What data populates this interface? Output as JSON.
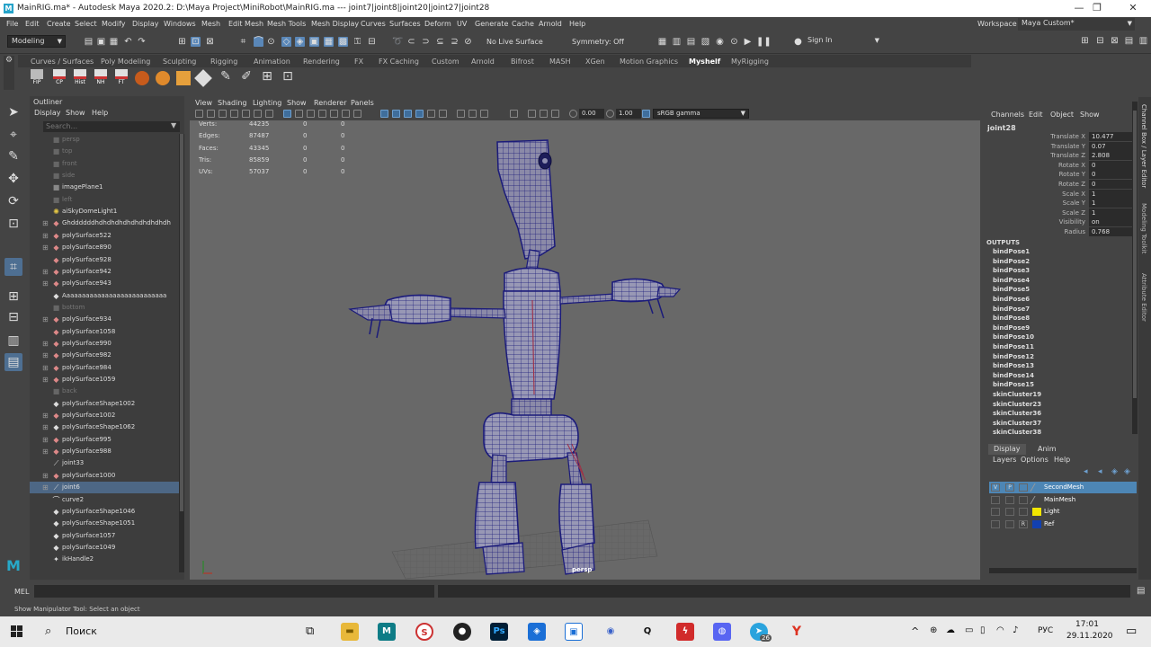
{
  "window": {
    "title": "MainRIG.ma* - Autodesk Maya 2020.2: D:\\Maya Project\\MiniRobot\\MainRIG.ma   ---   joint7|joint8|joint20|joint27|joint28",
    "logo": "M",
    "controls": [
      "—",
      "❐",
      "✕"
    ]
  },
  "menubar": {
    "items": [
      "File",
      "Edit",
      "Create",
      "Select",
      "Modify",
      "Display",
      "Windows",
      "Mesh",
      "Edit Mesh",
      "Mesh Tools",
      "Mesh Display",
      "Curves",
      "Surfaces",
      "Deform",
      "UV",
      "Generate",
      "Cache",
      "Arnold",
      "Help"
    ],
    "workspace_label": "Workspace :",
    "workspace_value": "Maya Custom*"
  },
  "statusline": {
    "mode": "Modeling",
    "live_surface": "No Live Surface",
    "symmetry": "Symmetry: Off",
    "sign_in": "Sign In"
  },
  "shelf": {
    "tabs": [
      "Curves / Surfaces",
      "Poly Modeling",
      "Sculpting",
      "Rigging",
      "Animation",
      "Rendering",
      "FX",
      "FX Caching",
      "Custom",
      "Arnold",
      "Bifrost",
      "MASH",
      "XGen",
      "Motion Graphics",
      "Myshelf",
      "MyRigging"
    ],
    "active": "Myshelf",
    "buttons": [
      "FIP",
      "CP",
      "Hist",
      "NH",
      "FT"
    ]
  },
  "outliner": {
    "title": "Outliner",
    "menu": [
      "Display",
      "Show",
      "Help"
    ],
    "search_placeholder": "Search...",
    "items": [
      {
        "label": "persp",
        "icon": "camera-icon",
        "dim": true,
        "expand": false
      },
      {
        "label": "top",
        "icon": "camera-icon",
        "dim": true,
        "expand": false
      },
      {
        "label": "front",
        "icon": "camera-icon",
        "dim": true,
        "expand": false
      },
      {
        "label": "side",
        "icon": "camera-icon",
        "dim": true,
        "expand": false
      },
      {
        "label": "imagePlane1",
        "icon": "camera-icon",
        "dim": false,
        "expand": false
      },
      {
        "label": "left",
        "icon": "camera-icon",
        "dim": true,
        "expand": false
      },
      {
        "label": "aiSkyDomeLight1",
        "icon": "light-icon",
        "dim": false,
        "expand": false
      },
      {
        "label": "Ghddddddhdhdhdhdhdhdhdhdhdh",
        "icon": "mesh-icon",
        "dim": false,
        "expand": true
      },
      {
        "label": "polySurface522",
        "icon": "mesh-icon",
        "dim": false,
        "expand": true
      },
      {
        "label": "polySurface890",
        "icon": "mesh-icon",
        "dim": false,
        "expand": true
      },
      {
        "label": "polySurface928",
        "icon": "mesh-icon",
        "dim": false,
        "expand": false
      },
      {
        "label": "polySurface942",
        "icon": "mesh-icon",
        "dim": false,
        "expand": true
      },
      {
        "label": "polySurface943",
        "icon": "mesh-icon",
        "dim": false,
        "expand": true
      },
      {
        "label": "Aaaaaaaaaaaaaaaaaaaaaaaaaaa",
        "icon": "group-icon",
        "dim": false,
        "expand": false
      },
      {
        "label": "bottom",
        "icon": "camera-icon",
        "dim": true,
        "expand": false
      },
      {
        "label": "polySurface934",
        "icon": "mesh-icon",
        "dim": false,
        "expand": true
      },
      {
        "label": "polySurface1058",
        "icon": "mesh-icon",
        "dim": false,
        "expand": false
      },
      {
        "label": "polySurface990",
        "icon": "mesh-icon",
        "dim": false,
        "expand": true
      },
      {
        "label": "polySurface982",
        "icon": "mesh-icon",
        "dim": false,
        "expand": true
      },
      {
        "label": "polySurface984",
        "icon": "mesh-icon",
        "dim": false,
        "expand": true
      },
      {
        "label": "polySurface1059",
        "icon": "mesh-icon",
        "dim": false,
        "expand": true
      },
      {
        "label": "back",
        "icon": "camera-icon",
        "dim": true,
        "expand": false
      },
      {
        "label": "polySurfaceShape1002",
        "icon": "group-icon",
        "dim": false,
        "expand": false
      },
      {
        "label": "polySurface1002",
        "icon": "mesh-icon",
        "dim": false,
        "expand": true
      },
      {
        "label": "polySurfaceShape1062",
        "icon": "group-icon",
        "dim": false,
        "expand": true
      },
      {
        "label": "polySurface995",
        "icon": "mesh-icon",
        "dim": false,
        "expand": true
      },
      {
        "label": "polySurface988",
        "icon": "mesh-icon",
        "dim": false,
        "expand": true
      },
      {
        "label": "joint33",
        "icon": "joint-icon",
        "dim": false,
        "expand": false
      },
      {
        "label": "polySurface1000",
        "icon": "mesh-icon",
        "dim": false,
        "expand": true
      },
      {
        "label": "joint6",
        "icon": "joint-icon",
        "dim": false,
        "expand": true,
        "selected": true
      },
      {
        "label": "curve2",
        "icon": "curve-icon",
        "dim": false,
        "expand": false
      },
      {
        "label": "polySurfaceShape1046",
        "icon": "group-icon",
        "dim": false,
        "expand": false
      },
      {
        "label": "polySurfaceShape1051",
        "icon": "group-icon",
        "dim": false,
        "expand": false
      },
      {
        "label": "polySurface1057",
        "icon": "group-icon",
        "dim": false,
        "expand": false
      },
      {
        "label": "polySurface1049",
        "icon": "group-icon",
        "dim": false,
        "expand": false
      },
      {
        "label": "ikHandle2",
        "icon": "ik-icon",
        "dim": false,
        "expand": false
      }
    ]
  },
  "viewport": {
    "menu": [
      "View",
      "Shading",
      "Lighting",
      "Show",
      "Renderer",
      "Panels"
    ],
    "near": "0.00",
    "far": "1.00",
    "colorspace": "sRGB gamma",
    "camera": "persp",
    "hud": [
      {
        "label": "Verts:",
        "v": [
          "44235",
          "0",
          "0"
        ]
      },
      {
        "label": "Edges:",
        "v": [
          "87487",
          "0",
          "0"
        ]
      },
      {
        "label": "Faces:",
        "v": [
          "43345",
          "0",
          "0"
        ]
      },
      {
        "label": "Tris:",
        "v": [
          "85859",
          "0",
          "0"
        ]
      },
      {
        "label": "UVs:",
        "v": [
          "57037",
          "0",
          "0"
        ]
      }
    ]
  },
  "channelbox": {
    "menu": [
      "Channels",
      "Edit",
      "Object",
      "Show"
    ],
    "object": "joint28",
    "attrs": [
      {
        "n": "Translate X",
        "v": "10.477"
      },
      {
        "n": "Translate Y",
        "v": "0.07"
      },
      {
        "n": "Translate Z",
        "v": "2.808"
      },
      {
        "n": "Rotate X",
        "v": "0"
      },
      {
        "n": "Rotate Y",
        "v": "0"
      },
      {
        "n": "Rotate Z",
        "v": "0"
      },
      {
        "n": "Scale X",
        "v": "1"
      },
      {
        "n": "Scale Y",
        "v": "1"
      },
      {
        "n": "Scale Z",
        "v": "1"
      },
      {
        "n": "Visibility",
        "v": "on"
      },
      {
        "n": "Radius",
        "v": "0.768"
      }
    ],
    "outputs_label": "OUTPUTS",
    "outputs": [
      "bindPose1",
      "bindPose2",
      "bindPose3",
      "bindPose4",
      "bindPose5",
      "bindPose6",
      "bindPose7",
      "bindPose8",
      "bindPose9",
      "bindPose10",
      "bindPose11",
      "bindPose12",
      "bindPose13",
      "bindPose14",
      "bindPose15",
      "skinCluster19",
      "skinCluster23",
      "skinCluster36",
      "skinCluster37",
      "skinCluster38"
    ]
  },
  "sidetabs": [
    "Channel Box / Layer Editor",
    "Modeling Toolkit",
    "Attribute Editor"
  ],
  "layers": {
    "tabs": [
      "Display",
      "Anim"
    ],
    "menu": [
      "Layers",
      "Options",
      "Help"
    ],
    "rows": [
      {
        "v": "V",
        "p": "P",
        "r": "",
        "name": "SecondMesh",
        "color": "",
        "selected": true
      },
      {
        "v": "",
        "p": "",
        "r": "",
        "name": "MainMesh",
        "color": "",
        "selected": false
      },
      {
        "v": "",
        "p": "",
        "r": "",
        "name": "Light",
        "color": "#f2e600",
        "selected": false
      },
      {
        "v": "",
        "p": "",
        "r": "R",
        "name": "Ref",
        "color": "#1240b0",
        "selected": false
      }
    ]
  },
  "mel": {
    "label": "MEL"
  },
  "help": "Show Manipulator Tool: Select an object",
  "taskbar": {
    "search": "Поиск",
    "lang": "РУС",
    "time": "17:01",
    "date": "29.11.2020",
    "badge": "26"
  }
}
